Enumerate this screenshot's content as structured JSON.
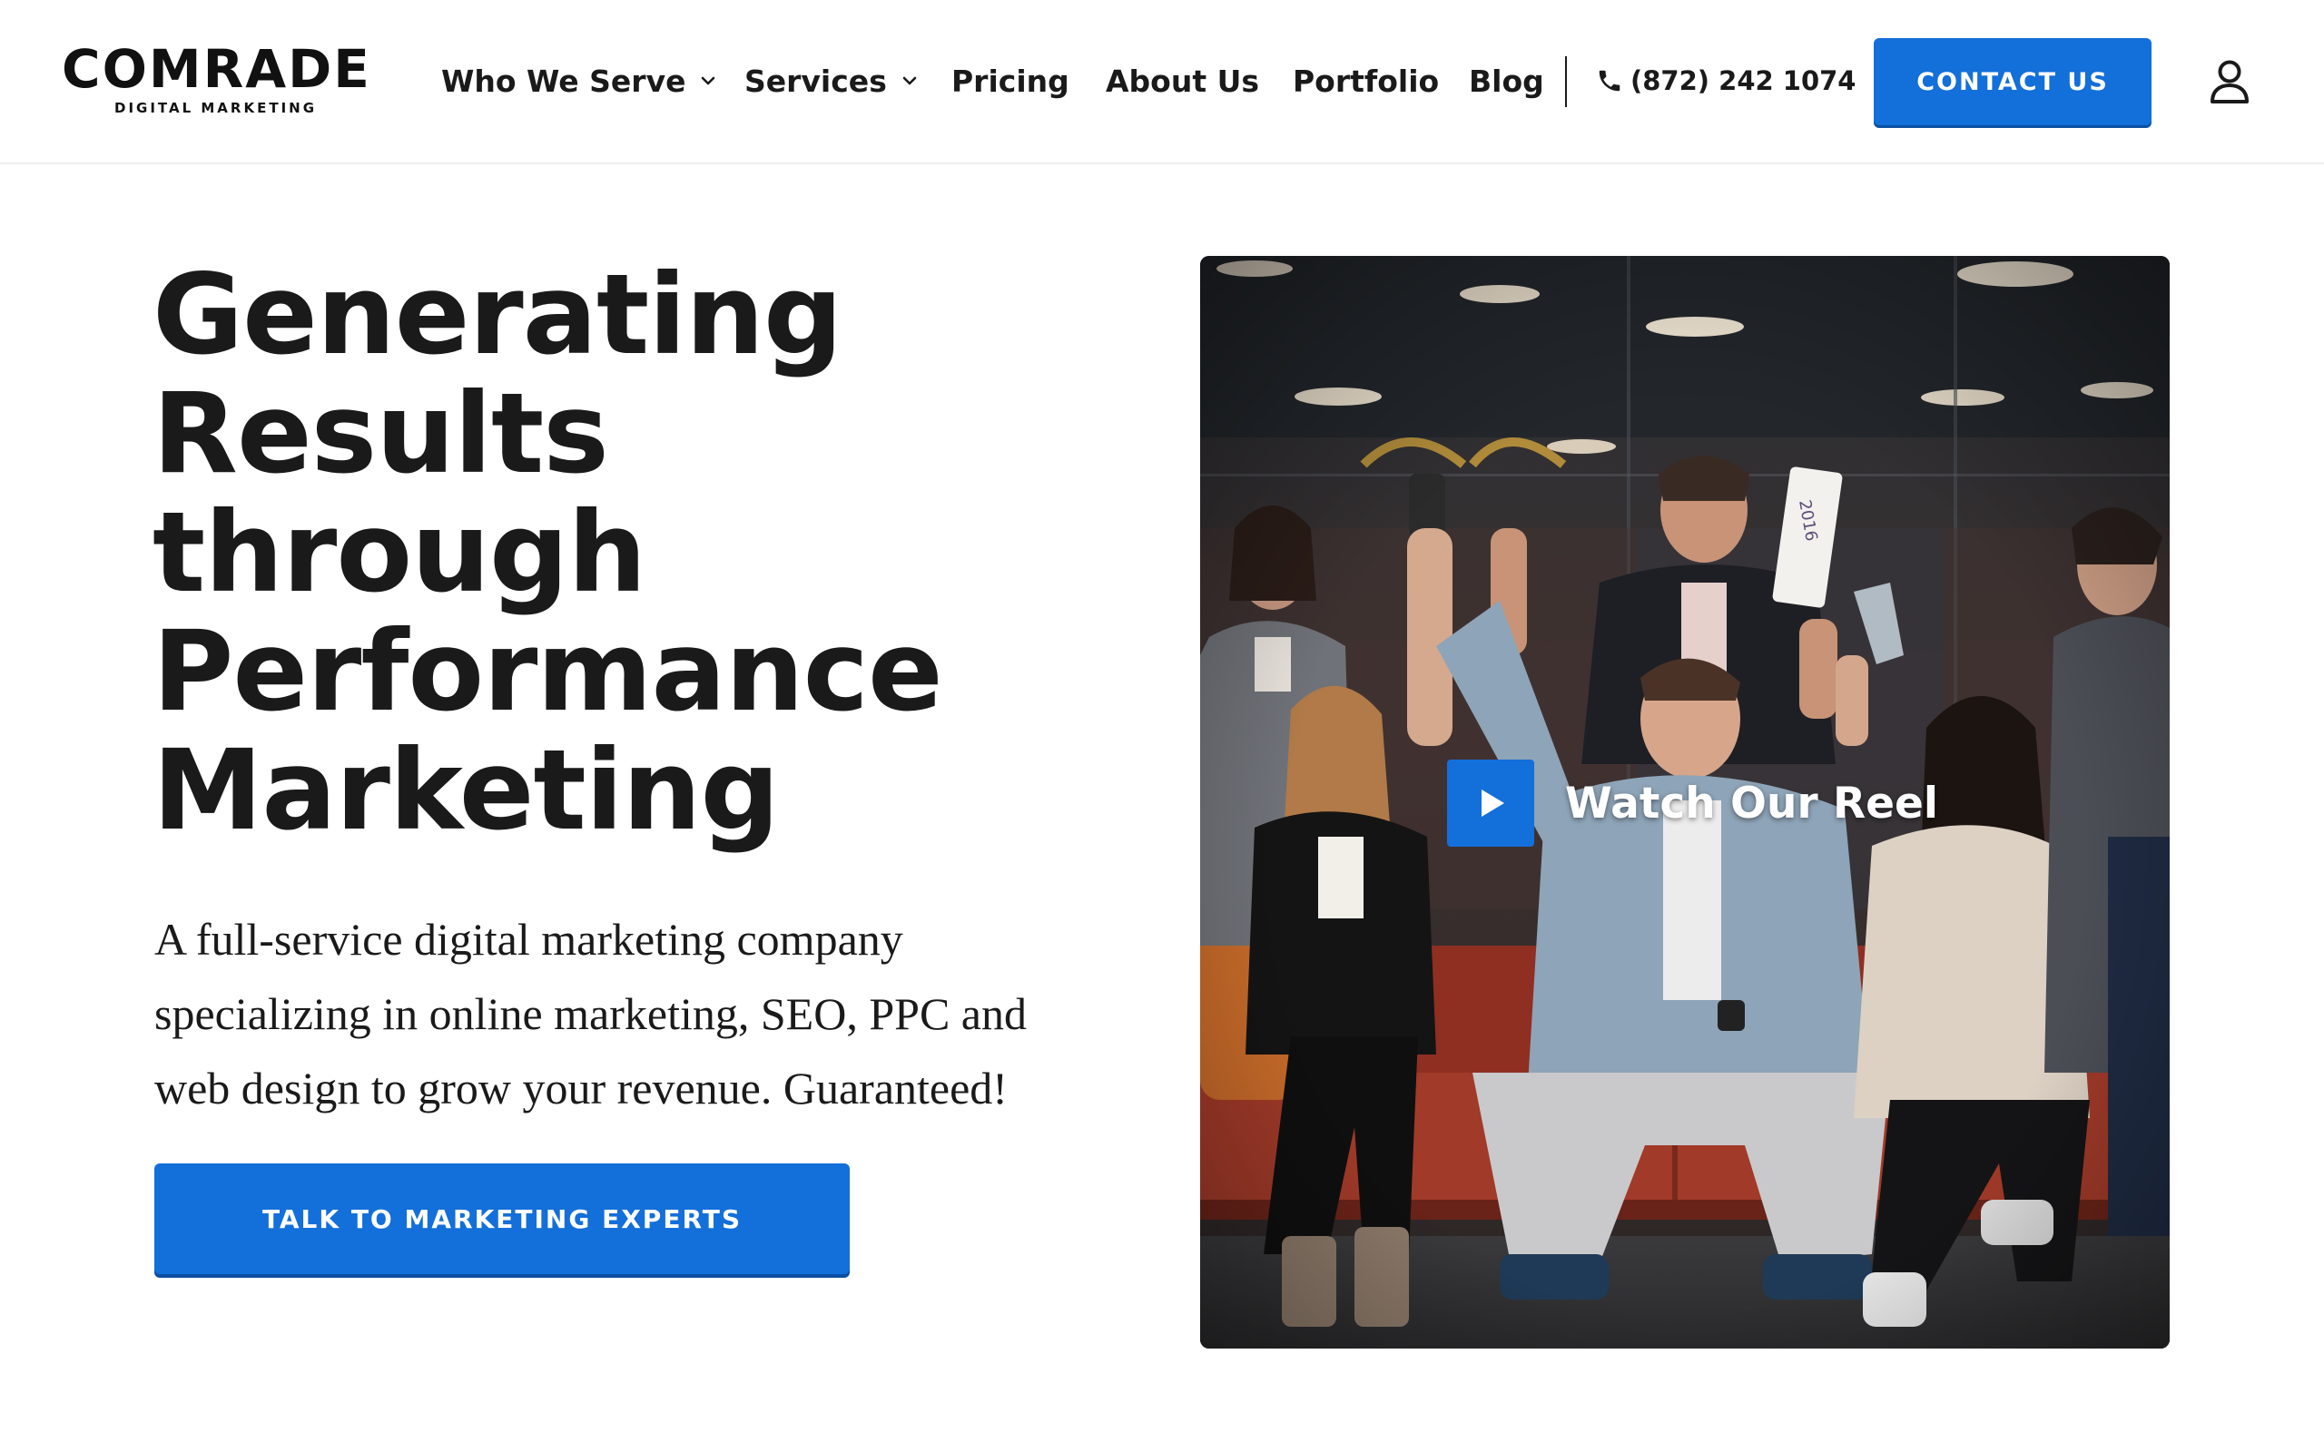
{
  "brand": {
    "name": "COMRADE",
    "tagline": "DIGITAL MARKETING"
  },
  "nav": {
    "items": [
      {
        "label": "Who We Serve",
        "has_dropdown": true
      },
      {
        "label": "Services",
        "has_dropdown": true
      },
      {
        "label": "Pricing",
        "has_dropdown": false
      },
      {
        "label": "About Us",
        "has_dropdown": false
      },
      {
        "label": "Portfolio",
        "has_dropdown": false
      },
      {
        "label": "Blog",
        "has_dropdown": false
      }
    ],
    "phone": "(872) 242 1074",
    "contact_label": "CONTACT US"
  },
  "hero": {
    "title_lines": [
      "Generating",
      "Results",
      "through",
      "Performance",
      "Marketing"
    ],
    "description": "A full-service digital marketing company specializing in online marketing, SEO, PPC and web design to grow your revenue. Guaranteed!",
    "cta_label": "TALK TO MARKETING EXPERTS"
  },
  "video": {
    "label": "Watch Our Reel",
    "trophy_text": "2016"
  },
  "icons": {
    "chevron": "chevron-down-icon",
    "phone": "phone-icon",
    "user": "user-icon",
    "play": "play-icon"
  },
  "colors": {
    "accent": "#136fd9",
    "text": "#1a1a1a",
    "background": "#ffffff"
  }
}
